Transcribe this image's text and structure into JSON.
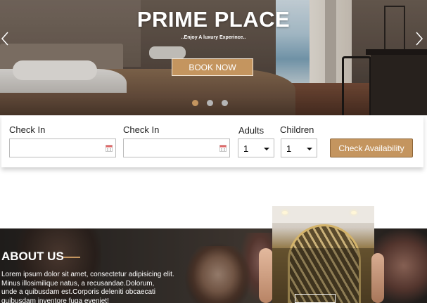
{
  "hero": {
    "title": "PRIME PLACE",
    "subtitle": "..Enjoy A luxury Experince..",
    "book_now_label": "BOOK NOW",
    "slides": 3,
    "active_slide": 1
  },
  "booking": {
    "checkin1_label": "Check In",
    "checkin2_label": "Check In",
    "adults_label": "Adults",
    "adults_value": "1",
    "children_label": "Children",
    "children_value": "1",
    "check_availability_label": "Check Availability"
  },
  "about": {
    "title": "ABOUT US",
    "line1": "Lorem ipsum dolor sit amet, consectetur adipisicing elit.",
    "line2": "Minus illosimilique natus, a recusandae.Dolorum,",
    "line3": "unde a quibusdam est.Corporis deleniti obcaecati",
    "line4": "quibusdam inventore fuga eveniet!"
  },
  "colors": {
    "accent": "#c4955f",
    "text": "#222222"
  },
  "icons": {
    "prev": "chevron-left-icon",
    "next": "chevron-right-icon",
    "calendar": "calendar-icon",
    "dropdown": "caret-down-icon"
  }
}
